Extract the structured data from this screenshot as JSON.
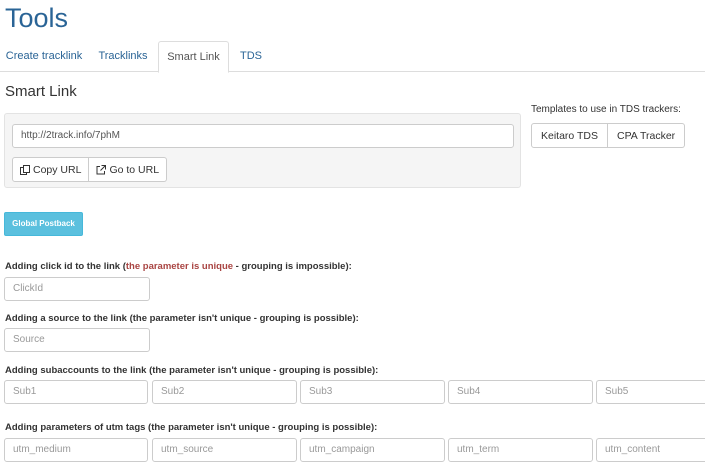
{
  "page": {
    "title": "Tools"
  },
  "tabs": [
    {
      "label": "Create tracklink"
    },
    {
      "label": "Tracklinks"
    },
    {
      "label": "Smart Link",
      "active": true
    },
    {
      "label": "TDS"
    }
  ],
  "smart_link": {
    "title": "Smart Link",
    "url": "http://2track.info/7phM",
    "copy_label": "Copy URL",
    "goto_label": "Go to URL"
  },
  "tds_templates": {
    "label": "Templates to use in TDS trackers:",
    "buttons": [
      "Keitaro TDS",
      "CPA Tracker"
    ]
  },
  "postback": {
    "label": "Global Postback"
  },
  "fields": {
    "clickid": {
      "label_pre": "Adding click id to the link (",
      "label_warn": "the parameter is unique",
      "label_post": " - grouping is impossible):",
      "placeholder": "ClickId"
    },
    "source": {
      "label": "Adding a source to the link (the parameter isn't unique - grouping is possible):",
      "placeholder": "Source"
    },
    "subs": {
      "label": "Adding subaccounts to the link (the parameter isn't unique - grouping is possible):",
      "placeholders": [
        "Sub1",
        "Sub2",
        "Sub3",
        "Sub4",
        "Sub5"
      ]
    },
    "utm": {
      "label": "Adding parameters of utm tags (the parameter isn't unique - grouping is possible):",
      "placeholders": [
        "utm_medium",
        "utm_source",
        "utm_campaign",
        "utm_term",
        "utm_content"
      ]
    }
  },
  "colors": {
    "link": "#2a6496",
    "info_button": "#5bc0de",
    "warning_text": "#a94442"
  }
}
